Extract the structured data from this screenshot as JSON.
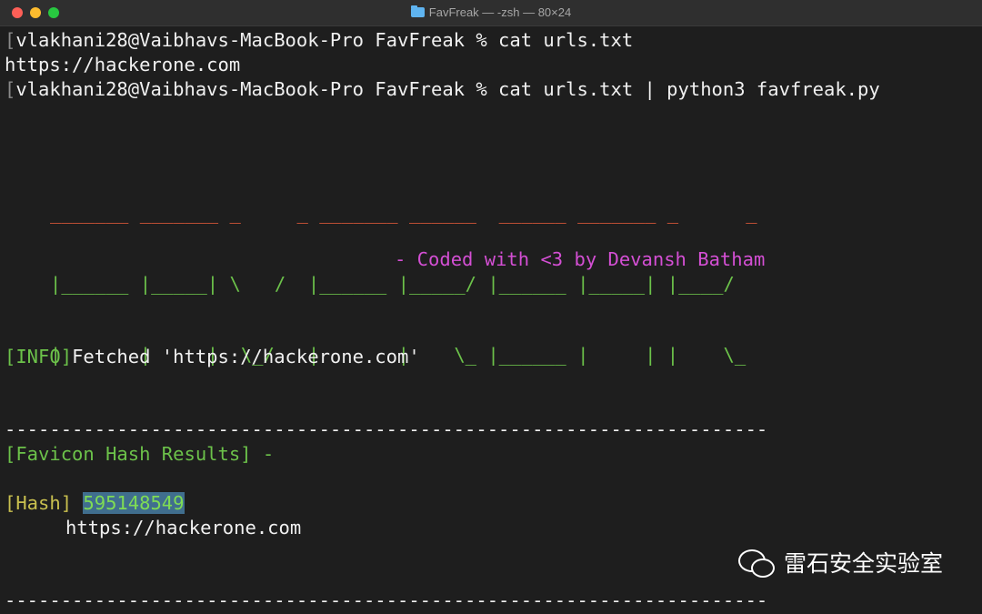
{
  "window": {
    "title": "FavFreak — -zsh — 80×24"
  },
  "terminal": {
    "cmd1_prompt": "vlakhani28@Vaibhavs-MacBook-Pro FavFreak % cat urls.txt",
    "cmd1_output": "https://hackerone.com",
    "cmd2_prompt": "vlakhani28@Vaibhavs-MacBook-Pro FavFreak % cat urls.txt | python3 favfreak.py",
    "banner_line1": "_______ _______ _     _ _______ ______  ______ _______ _      _",
    "banner_line2": "|______ |_____| \\   /  |______ |_____/ |______ |_____| |____/",
    "banner_line3": "|       |     |  \\_/   |       |    \\_ |______ |     | |    \\_",
    "credit": "- Coded with <3 by Devansh Batham",
    "info_tag": "[INFO]",
    "info_text": "Fetched 'https://hackerone.com'",
    "separator": "--------------------------------------------------------------------",
    "results_header": "[Favicon Hash Results] -",
    "hash_tag": "[Hash]",
    "hash_value": "595148549",
    "hash_url": "https://hackerone.com"
  },
  "watermark": {
    "text": "雷石安全实验室",
    "icon": "wechat-icon"
  },
  "colors": {
    "background": "#1e1e1e",
    "green": "#6cc24a",
    "magenta": "#d44fd4",
    "yellow": "#c9c04f",
    "highlight": "#406e8e"
  }
}
